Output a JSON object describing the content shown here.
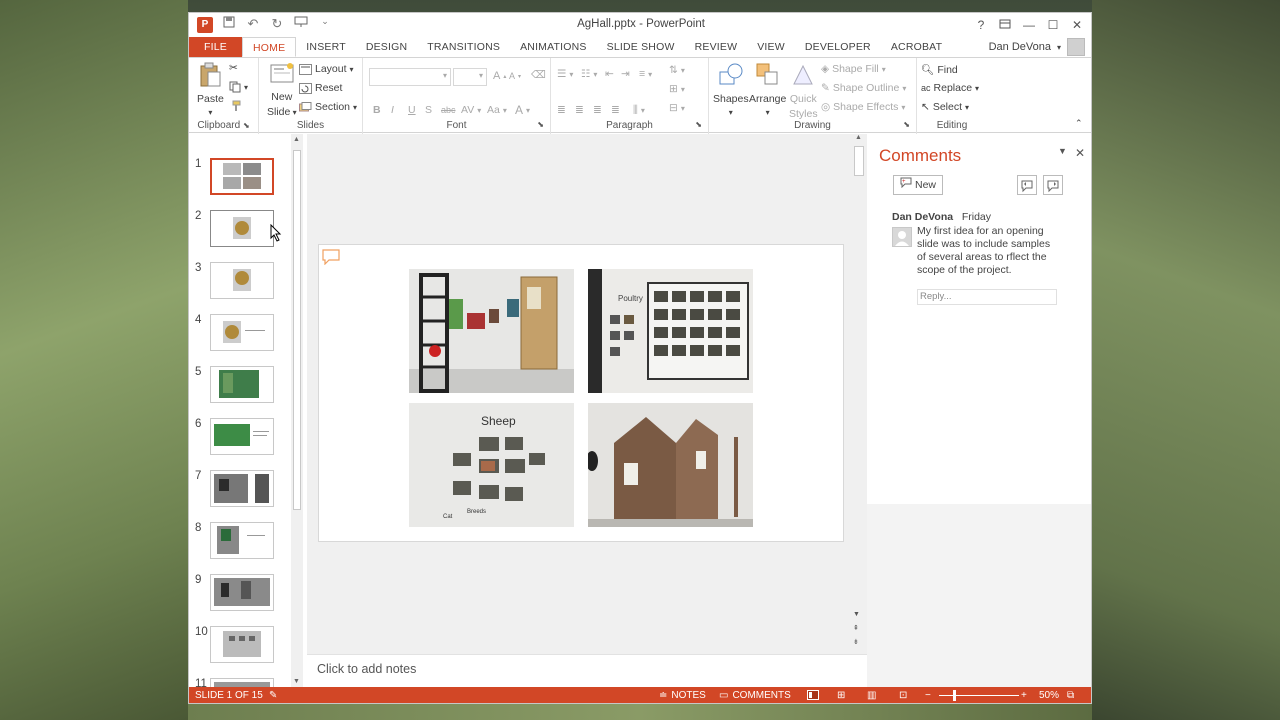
{
  "window": {
    "title": "AgHall.pptx - PowerPoint"
  },
  "title_controls": [
    "?",
    "□",
    "—",
    "☐",
    "✕"
  ],
  "tabs": [
    "FILE",
    "HOME",
    "INSERT",
    "DESIGN",
    "TRANSITIONS",
    "ANIMATIONS",
    "SLIDE SHOW",
    "REVIEW",
    "VIEW",
    "DEVELOPER",
    "ACROBAT"
  ],
  "active_tab": "HOME",
  "user": {
    "name": "Dan DeVona"
  },
  "ribbon": {
    "clipboard": {
      "paste": "Paste",
      "label": "Clipboard"
    },
    "slides": {
      "new_slide": "New",
      "new_slide2": "Slide",
      "layout": "Layout",
      "reset": "Reset",
      "section": "Section",
      "label": "Slides"
    },
    "font": {
      "label": "Font",
      "bold": "B",
      "italic": "I",
      "underline": "U",
      "shadow": "S",
      "strike": "abc",
      "spacing": "AV",
      "case": "Aa",
      "color": "A"
    },
    "paragraph": {
      "label": "Paragraph"
    },
    "drawing": {
      "shapes": "Shapes",
      "arrange": "Arrange",
      "quick_styles": "Quick",
      "quick_styles2": "Styles",
      "shape_fill": "Shape Fill",
      "shape_outline": "Shape Outline",
      "shape_effects": "Shape Effects",
      "label": "Drawing"
    },
    "editing": {
      "find": "Find",
      "replace": "Replace",
      "select": "Select",
      "label": "Editing"
    }
  },
  "slides": [
    {
      "num": "1"
    },
    {
      "num": "2"
    },
    {
      "num": "3"
    },
    {
      "num": "4"
    },
    {
      "num": "5"
    },
    {
      "num": "6"
    },
    {
      "num": "7"
    },
    {
      "num": "8"
    },
    {
      "num": "9"
    },
    {
      "num": "10"
    },
    {
      "num": "11"
    }
  ],
  "current_slide": {
    "photos": [
      {
        "caption": ""
      },
      {
        "caption": "Poultry"
      },
      {
        "caption": "Sheep",
        "sub1": "Cat",
        "sub2": "Breeds"
      },
      {
        "caption": ""
      }
    ]
  },
  "notes": {
    "placeholder": "Click to add notes"
  },
  "comments": {
    "title": "Comments",
    "new_label": "New",
    "author": "Dan DeVona",
    "when": "Friday",
    "text": "My first idea for an opening slide was to include samples of several areas to rflect the scope of the project.",
    "reply_placeholder": "Reply..."
  },
  "status": {
    "slide_of": "SLIDE 1 OF 15",
    "notes": "NOTES",
    "comments": "COMMENTS",
    "zoom": "50%"
  },
  "colors": {
    "accent": "#d24726"
  }
}
